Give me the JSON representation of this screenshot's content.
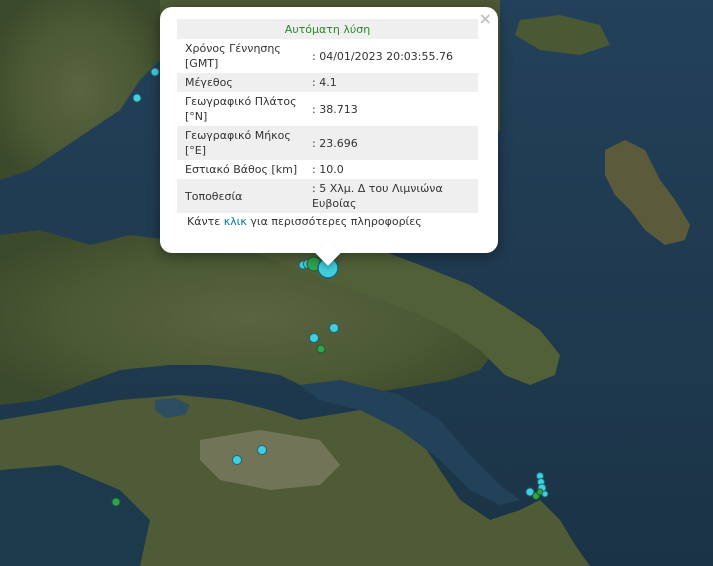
{
  "popup": {
    "title": "Αυτόματη λύση",
    "close_label": "×",
    "rows": [
      {
        "label": "Χρόνος Γέννησης [GMT]",
        "value": ": 04/01/2023 20:03:55.76"
      },
      {
        "label": "Μέγεθος",
        "value": ": 4.1"
      },
      {
        "label": "Γεωγραφικό Πλάτος [°N]",
        "value": ": 38.713"
      },
      {
        "label": "Γεωγραφικό Μήκος [°E]",
        "value": ": 23.696"
      },
      {
        "label": "Εστιακό Βάθος [km]",
        "value": ": 10.0"
      },
      {
        "label": "Τοποθεσία",
        "value": ": 5 Χλμ. Δ του Λιμνιώνα Ευβοίας"
      }
    ],
    "more_prefix": "Κάντε ",
    "more_link": "κλικ",
    "more_suffix": " για περισσότερες πληροφορίες"
  },
  "colors": {
    "sea": "#1e3a4c",
    "land": "#4a5a32",
    "marker_cyan": "#41cfe0",
    "marker_green": "#2fa44f",
    "popup_title": "#2c8a2c",
    "link": "#0078a8"
  },
  "markers": {
    "cyan_count": 14,
    "green_count": 5
  }
}
